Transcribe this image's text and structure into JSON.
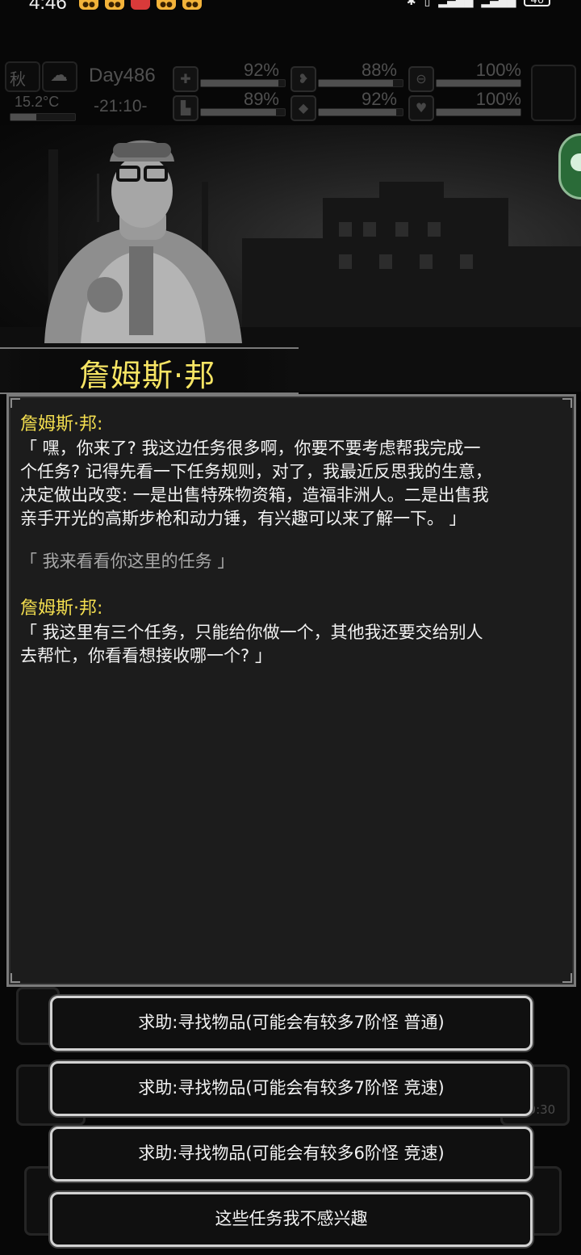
{
  "status_bar": {
    "time": "4:46",
    "battery": "46"
  },
  "hud": {
    "season": "秋",
    "temperature": "15.2°C",
    "day": "Day486",
    "clock": "-21:10-",
    "stats": [
      {
        "icon": "health-kit-icon",
        "value": "92%"
      },
      {
        "icon": "stomach-icon",
        "value": "88%"
      },
      {
        "icon": "capsule-icon",
        "value": "100%"
      },
      {
        "icon": "boot-icon",
        "value": "89%"
      },
      {
        "icon": "water-drop-icon",
        "value": "92%"
      },
      {
        "icon": "heart-icon",
        "value": "100%"
      }
    ],
    "stat_levels": [
      0.92,
      0.88,
      1.0,
      0.89,
      0.92,
      1.0
    ]
  },
  "npc": {
    "name": "詹姆斯·邦"
  },
  "dialog": {
    "messages": [
      {
        "speaker": "詹姆斯·邦:",
        "lines": [
          "「 嘿，你来了? 我这边任务很多啊，你要不要考虑帮我完成一",
          "个任务? 记得先看一下任务规则，对了，我最近反思我的生意，",
          "决定做出改变: 一是出售特殊物资箱，造福非洲人。二是出售我",
          "亲手开光的高斯步枪和动力锤，有兴趣可以来了解一下。 」"
        ]
      },
      {
        "reply": "「 我来看看你这里的任务 」"
      },
      {
        "speaker": "詹姆斯·邦:",
        "lines": [
          "「 我这里有三个任务，只能给你做一个，其他我还要交给别人",
          "去帮忙，你看看想接收哪一个? 」"
        ]
      }
    ]
  },
  "choices": [
    "求助:寻找物品(可能会有较多7阶怪  普通)",
    "求助:寻找物品(可能会有较多7阶怪  竞速)",
    "求助:寻找物品(可能会有较多6阶怪  竞速)",
    "这些任务我不感兴趣"
  ],
  "background_timer": "00:30"
}
